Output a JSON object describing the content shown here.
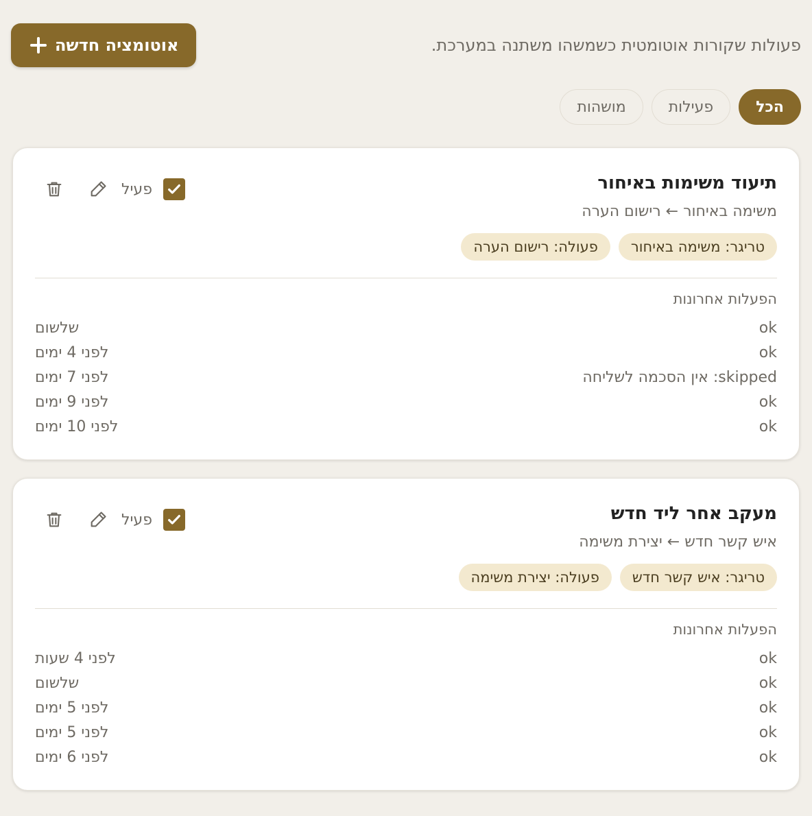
{
  "header": {
    "subtitle": "פעולות שקורות אוטומטית כשמשהו משתנה במערכת.",
    "new_button_label": "אוטומציה חדשה"
  },
  "tabs": [
    {
      "label": "הכל",
      "active": true
    },
    {
      "label": "פעילות",
      "active": false
    },
    {
      "label": "מושהות",
      "active": false
    }
  ],
  "automations": [
    {
      "title": "תיעוד משימות באיחור",
      "description": "משימה באיחור ← רישום הערה",
      "active_label": "פעיל",
      "enabled": true,
      "trigger_chip": "טריגר: משימה באיחור",
      "action_chip": "פעולה: רישום הערה",
      "runs_heading": "הפעלות אחרונות",
      "runs": [
        {
          "status": "ok",
          "time": "שלשום"
        },
        {
          "status": "ok",
          "time": "לפני 4 ימים"
        },
        {
          "status": "skipped: אין הסכמה לשליחה",
          "time": "לפני 7 ימים"
        },
        {
          "status": "ok",
          "time": "לפני 9 ימים"
        },
        {
          "status": "ok",
          "time": "לפני 10 ימים"
        }
      ]
    },
    {
      "title": "מעקב אחר ליד חדש",
      "description": "איש קשר חדש ← יצירת משימה",
      "active_label": "פעיל",
      "enabled": true,
      "trigger_chip": "טריגר: איש קשר חדש",
      "action_chip": "פעולה: יצירת משימה",
      "runs_heading": "הפעלות אחרונות",
      "runs": [
        {
          "status": "ok",
          "time": "לפני 4 שעות"
        },
        {
          "status": "ok",
          "time": "שלשום"
        },
        {
          "status": "ok",
          "time": "לפני 5 ימים"
        },
        {
          "status": "ok",
          "time": "לפני 5 ימים"
        },
        {
          "status": "ok",
          "time": "לפני 6 ימים"
        }
      ]
    }
  ],
  "colors": {
    "accent": "#87692a",
    "chip_bg": "#f3e9cf",
    "page_bg": "#f2efe9"
  }
}
